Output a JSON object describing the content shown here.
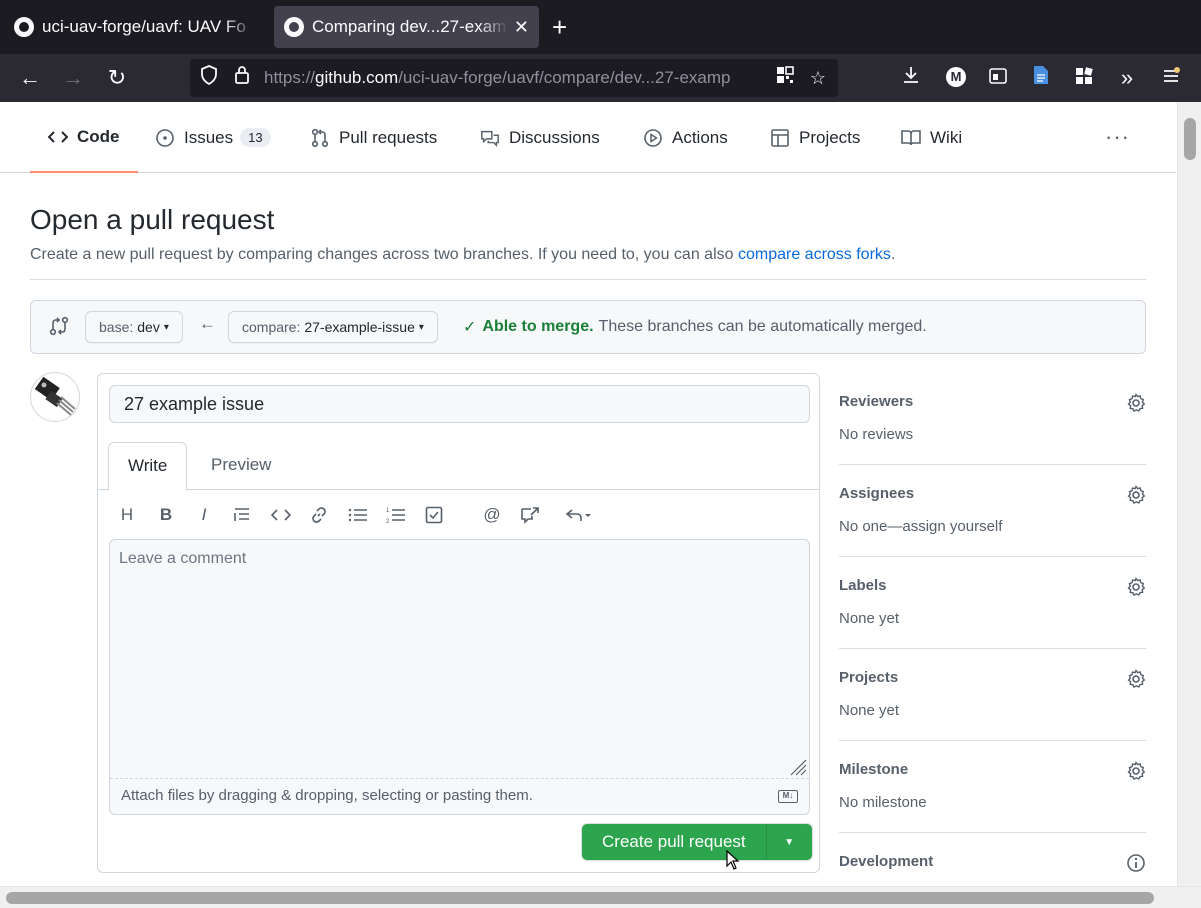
{
  "browser": {
    "tabs": [
      {
        "title": "uci-uav-forge/uavf: UAV Fo",
        "active": false
      },
      {
        "title": "Comparing dev...27-examp",
        "active": true
      }
    ],
    "url_prefix": "https://",
    "url_domain": "github.com",
    "url_path": "/uci-uav-forge/uavf/compare/dev...27-examp",
    "account_initial": "M"
  },
  "repo_nav": {
    "code": "Code",
    "issues": "Issues",
    "issues_count": "13",
    "pull_requests": "Pull requests",
    "discussions": "Discussions",
    "actions": "Actions",
    "projects": "Projects",
    "wiki": "Wiki",
    "more": "···"
  },
  "page": {
    "title": "Open a pull request",
    "subtitle": "Create a new pull request by comparing changes across two branches. If you need to, you can also ",
    "subtitle_link": "compare across forks",
    "subtitle_end": "."
  },
  "range": {
    "base_label": "base:",
    "base_value": "dev",
    "compare_label": "compare:",
    "compare_value": "27-example-issue",
    "merge_status": "Able to merge.",
    "merge_detail": "These branches can be automatically merged."
  },
  "form": {
    "title_value": "27 example issue",
    "tab_write": "Write",
    "tab_preview": "Preview",
    "comment_placeholder": "Leave a comment",
    "attach_hint": "Attach files by dragging & dropping, selecting or pasting them.",
    "markdown_badge": "M↓",
    "create_button": "Create pull request"
  },
  "sidebar": [
    {
      "heading": "Reviewers",
      "value": "No reviews"
    },
    {
      "heading": "Assignees",
      "value": "No one—assign yourself"
    },
    {
      "heading": "Labels",
      "value": "None yet"
    },
    {
      "heading": "Projects",
      "value": "None yet"
    },
    {
      "heading": "Milestone",
      "value": "No milestone"
    },
    {
      "heading": "Development",
      "value": ""
    }
  ],
  "colors": {
    "accent_green": "#2da44e",
    "merge_green": "#1a7f37",
    "link_blue": "#0969da",
    "tab_underline": "#fd8c73"
  }
}
